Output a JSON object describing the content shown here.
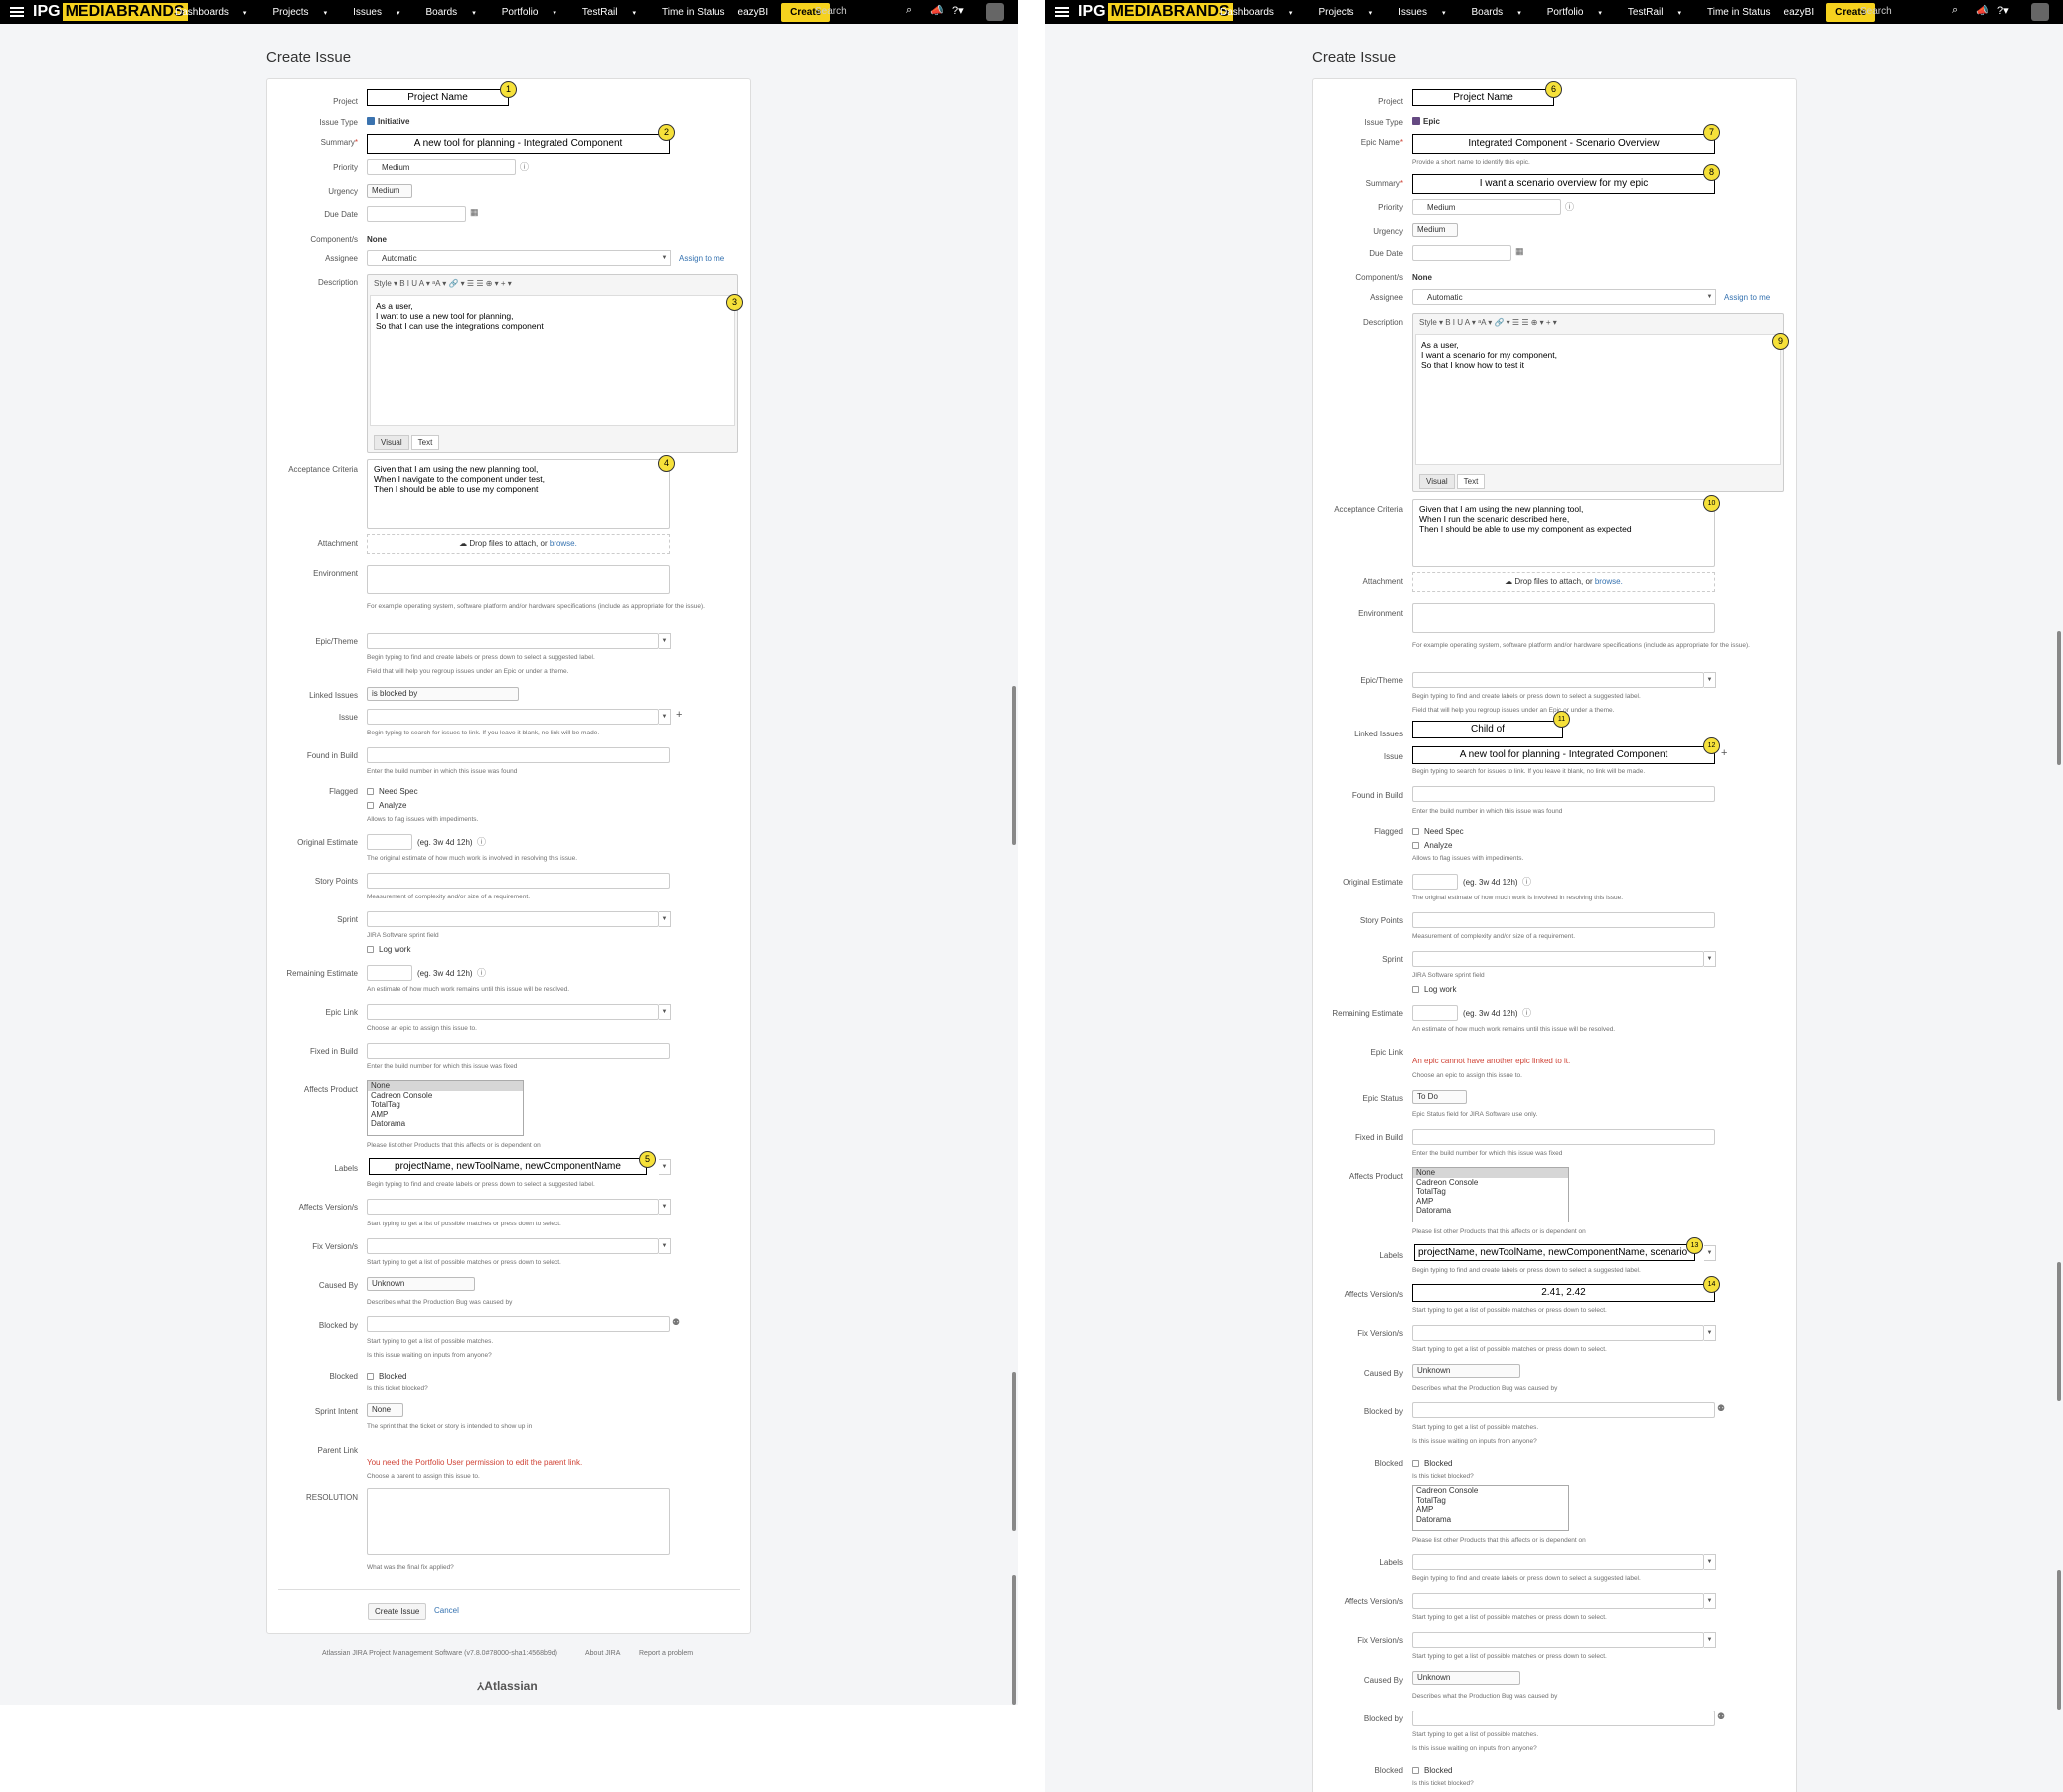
{
  "topbar": {
    "logo_left": "IPG",
    "logo_right": "MEDIABRANDS",
    "nav": [
      "Dashboards",
      "Projects",
      "Issues",
      "Boards",
      "Portfolio",
      "TestRail",
      "Time in Status",
      "eazyBI"
    ],
    "create": "Create",
    "search_placeholder": "Search"
  },
  "page_title": "Create Issue",
  "labels": {
    "project": "Project",
    "issue_type": "Issue Type",
    "epic_name": "Epic Name",
    "summary": "Summary",
    "priority": "Priority",
    "urgency": "Urgency",
    "due_date": "Due Date",
    "components": "Component/s",
    "assignee": "Assignee",
    "description": "Description",
    "acceptance": "Acceptance Criteria",
    "attachment": "Attachment",
    "environment": "Environment",
    "epic_theme": "Epic/Theme",
    "linked_issues": "Linked Issues",
    "issue": "Issue",
    "found_in_build": "Found in Build",
    "flagged": "Flagged",
    "original_estimate": "Original Estimate",
    "story_points": "Story Points",
    "sprint": "Sprint",
    "remaining_estimate": "Remaining Estimate",
    "epic_link": "Epic Link",
    "epic_status": "Epic Status",
    "fixed_in_build": "Fixed in Build",
    "affects_product": "Affects Product",
    "labels": "Labels",
    "affects_versions": "Affects Version/s",
    "fix_versions": "Fix Version/s",
    "caused_by": "Caused By",
    "blocked_by": "Blocked by",
    "blocked": "Blocked",
    "sprint_intent": "Sprint Intent",
    "parent_link": "Parent Link",
    "resolution": "RESOLUTION"
  },
  "hints": {
    "epic_name": "Provide a short name to identify this epic.",
    "environment": "For example operating system, software platform and/or hardware specifications (include as appropriate for the issue).",
    "epic_theme_1": "Begin typing to find and create labels or press down to select a suggested label.",
    "epic_theme_2": "Field that will help you regroup issues under an Epic or under a theme.",
    "issue": "Begin typing to search for issues to link. If you leave it blank, no link will be made.",
    "found_in_build": "Enter the build number in which this issue was found",
    "flagged": "Allows to flag issues with impediments.",
    "original_estimate": "The original estimate of how much work is involved in resolving this issue.",
    "story_points": "Measurement of complexity and/or size of a requirement.",
    "sprint": "JIRA Software sprint field",
    "remaining_estimate": "An estimate of how much work remains until this issue will be resolved.",
    "epic_link": "Choose an epic to assign this issue to.",
    "epic_status": "Epic Status field for JIRA Software use only.",
    "fixed_in_build": "Enter the build number for which this issue was fixed",
    "affects_product": "Please list other Products that this affects or is dependent on",
    "labels": "Begin typing to find and create labels or press down to select a suggested label.",
    "versions": "Start typing to get a list of possible matches or press down to select.",
    "caused_by": "Describes what the Production Bug was caused by",
    "blocked_by_1": "Start typing to get a list of possible matches.",
    "blocked_by_2": "Is this issue waiting on inputs from anyone?",
    "blocked": "Is this ticket blocked?",
    "sprint_intent": "The sprint that the ticket or story is intended to show up in",
    "parent_link": "Choose a parent to assign this issue to.",
    "resolution": "What was the final fix applied?"
  },
  "common": {
    "medium": "Medium",
    "none_bold": "None",
    "automatic": "Automatic",
    "assign_to_me": "Assign to me",
    "editor_toolbar": "Style ▾   B   I   U   A ▾  ᵃA ▾   🔗 ▾   ☰   ☰   ⊕ ▾   + ▾",
    "visual": "Visual",
    "text": "Text",
    "attach_text": "Drop files to attach, or ",
    "attach_link": "browse.",
    "estimate_eg": "(eg. 3w 4d 12h)",
    "need_spec": "Need Spec",
    "analyze": "Analyze",
    "log_work": "Log work",
    "unknown": "Unknown",
    "blocked_cb": "Blocked",
    "none_small": "None",
    "products": [
      "None",
      "Cadreon Console",
      "TotalTag",
      "AMP",
      "Datorama"
    ],
    "products_no_none": [
      "Cadreon Console",
      "TotalTag",
      "AMP",
      "Datorama"
    ]
  },
  "left": {
    "project": "Project Name",
    "issue_type": "Initiative",
    "summary": "A new tool for planning - Integrated Component",
    "description": [
      "As a user,",
      "I want to use a new tool for planning,",
      "So that I can use the integrations component"
    ],
    "acceptance": [
      "Given that I am using the new planning tool,",
      "When I navigate to the component under test,",
      "Then I should be able to use my component"
    ],
    "linked_issues": "is blocked by",
    "labels": "projectName, newToolName, newComponentName",
    "parent_link_error": "You need the Portfolio User permission to edit the parent link.",
    "create_button": "Create Issue",
    "cancel": "Cancel",
    "footer": [
      "Atlassian JIRA Project Management Software (v7.8.0#78000-sha1:4568b9d)",
      "About JIRA",
      "Report a problem"
    ],
    "atlassian": "Atlassian",
    "badges": [
      "1",
      "2",
      "3",
      "4",
      "5"
    ]
  },
  "right": {
    "project": "Project Name",
    "issue_type": "Epic",
    "epic_name": "Integrated Component - Scenario Overview",
    "summary": "I want a scenario overview for my epic",
    "description": [
      "As a user,",
      "I want a scenario for my component,",
      "So that I know how to test it"
    ],
    "acceptance": [
      "Given that I am using the new planning tool,",
      "When I run the scenario described here,",
      "Then I should be able to use my component as expected"
    ],
    "linked_issues": "Child of",
    "issue": "A new tool for planning - Integrated Component",
    "epic_link_error": "An epic cannot have another epic linked to it.",
    "epic_status": "To Do",
    "labels": "projectName, newToolName, newComponentName, scenario",
    "affects_versions": "2.41, 2.42",
    "badges": [
      "6",
      "7",
      "8",
      "9",
      "10",
      "11",
      "12",
      "13",
      "14"
    ]
  }
}
